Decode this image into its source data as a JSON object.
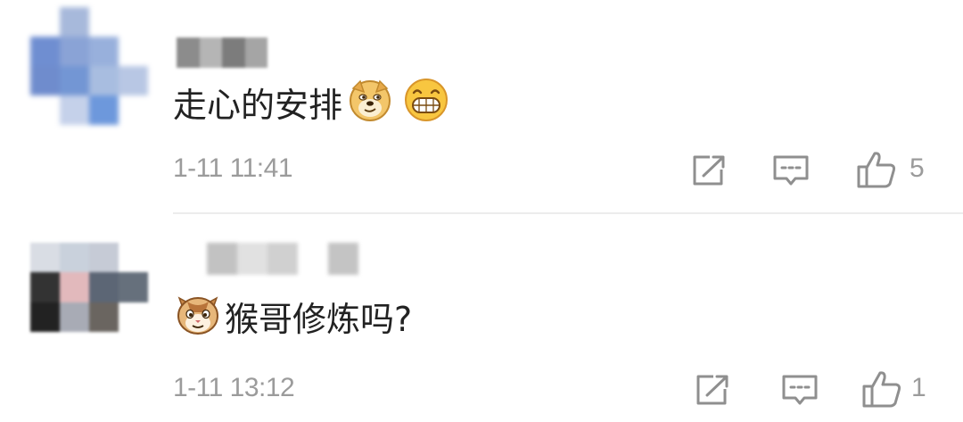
{
  "comments": [
    {
      "text": "走心的安排",
      "time": "1-11 11:41",
      "like_count": "5",
      "avatar_colors": [
        "#ffffff",
        "#a7b9db",
        "#ffffff",
        "#ffffff",
        "#6f8ed1",
        "#8aa3d6",
        "#98b0dc",
        "#ffffff",
        "#6f8ccd",
        "#7396d4",
        "#a8bde0",
        "#b8c7e4",
        "#ffffff",
        "#c5d1ea",
        "#6d98dc",
        "#ffffff"
      ],
      "name_colors": [
        "#8c8c8c",
        "#b5b5b5",
        "#7c7c7c",
        "#a5a5a5"
      ],
      "emojis": [
        "doge-emoji-icon",
        "grin-emoji-icon"
      ]
    },
    {
      "text": "猴哥修炼吗?",
      "time": "1-11 13:12",
      "like_count": "1",
      "avatar_colors": [
        "#d9dde4",
        "#c9d1dc",
        "#c6cbd6",
        "#ffffff",
        "#333333",
        "#e2b9bc",
        "#5c6675",
        "#66707c",
        "#222222",
        "#a8abb5",
        "#6a6560",
        "#ffffff"
      ],
      "name_colors": [
        "#c2c2c2",
        "#e1e1e1",
        "#d0d0d0",
        "#ffffff",
        "#c4c4c4"
      ],
      "emojis": [
        "cat-emoji-icon"
      ]
    }
  ],
  "colors": {
    "meta_text": "#9b9b9b",
    "icon_stroke": "#8f8f8f",
    "comment_text": "#222222",
    "divider": "#ececec"
  },
  "actions": [
    "share-icon",
    "reply-icon",
    "like-icon"
  ]
}
